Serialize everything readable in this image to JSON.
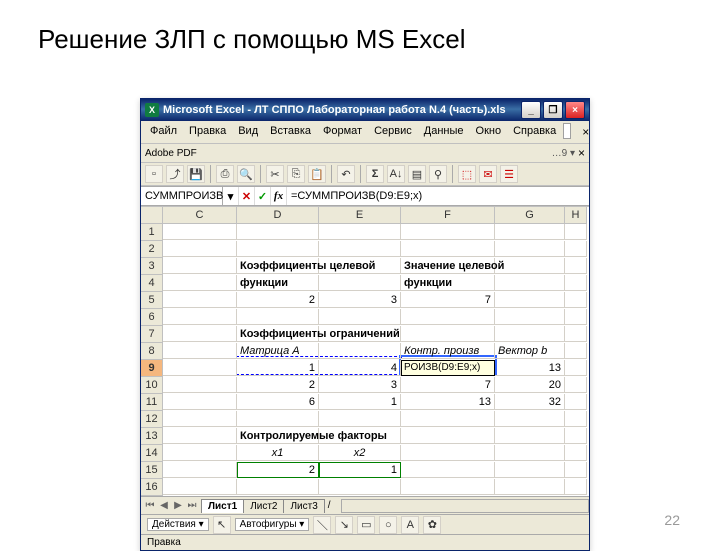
{
  "slide": {
    "title": "Решение ЗЛП с помощью MS Excel",
    "page_number": "22"
  },
  "window": {
    "app_name": "Microsoft Excel",
    "doc_name": "ЛТ СППО Лабораторная работа N.4 (часть).xls"
  },
  "menu": {
    "items": [
      "Файл",
      "Правка",
      "Вид",
      "Вставка",
      "Формат",
      "Сервис",
      "Данные",
      "Окно",
      "Справка"
    ],
    "type_question_placeholder": ""
  },
  "toolbar": {
    "adobe_label": "Adobe PDF",
    "sigma": "Σ"
  },
  "formula": {
    "namebox": "СУММПРОИЗВ",
    "text": "=СУММПРОИЗВ(D9:E9;x)"
  },
  "columns": [
    "C",
    "D",
    "E",
    "F",
    "G",
    "H"
  ],
  "rows": [
    {
      "n": "1",
      "cells": [
        "",
        "",
        "",
        "",
        "",
        ""
      ]
    },
    {
      "n": "2",
      "cells": [
        "",
        "",
        "",
        "",
        "",
        ""
      ]
    },
    {
      "n": "3",
      "cells": [
        "",
        "Коэффициенты целевой",
        "",
        "Значение целевой",
        "",
        ""
      ],
      "bold": true
    },
    {
      "n": "4",
      "cells": [
        "",
        "функции",
        "",
        "функции",
        "",
        ""
      ],
      "bold": true
    },
    {
      "n": "5",
      "cells": [
        "",
        "2",
        "3",
        "7",
        "",
        ""
      ],
      "align": "r"
    },
    {
      "n": "6",
      "cells": [
        "",
        "",
        "",
        "",
        "",
        ""
      ]
    },
    {
      "n": "7",
      "cells": [
        "",
        "Коэффициенты ограничений",
        "",
        "",
        "",
        ""
      ],
      "bold": true
    },
    {
      "n": "8",
      "cells": [
        "",
        "Матрица А",
        "",
        "Контр. произв",
        "Вектор b",
        ""
      ],
      "ital": true
    },
    {
      "n": "9",
      "cells": [
        "",
        "1",
        "4",
        "РОИЗВ(D9:E9;x)",
        "13",
        ""
      ],
      "sel": true,
      "tt": true
    },
    {
      "n": "10",
      "cells": [
        "",
        "2",
        "3",
        "7",
        "20",
        ""
      ],
      "align": "r"
    },
    {
      "n": "11",
      "cells": [
        "",
        "6",
        "1",
        "13",
        "32",
        ""
      ],
      "align": "r"
    },
    {
      "n": "12",
      "cells": [
        "",
        "",
        "",
        "",
        "",
        ""
      ]
    },
    {
      "n": "13",
      "cells": [
        "",
        "Контролируемые факторы",
        "",
        "",
        "",
        ""
      ],
      "bold": true
    },
    {
      "n": "14",
      "cells": [
        "",
        "x1",
        "x2",
        "",
        "",
        ""
      ],
      "ital": true,
      "align": "c"
    },
    {
      "n": "15",
      "cells": [
        "",
        "2",
        "1",
        "",
        "",
        ""
      ],
      "align": "r",
      "green": true
    },
    {
      "n": "16",
      "cells": [
        "",
        "",
        "",
        "",
        "",
        ""
      ]
    }
  ],
  "sheet_tabs": {
    "nav": [
      "⏮",
      "◀",
      "▶",
      "⏭"
    ],
    "tabs": [
      "Лист1",
      "Лист2",
      "Лист3"
    ]
  },
  "drawing": {
    "actions_label": "Действия",
    "autoshapes_label": "Автофигуры"
  },
  "statusbar": {
    "text": "Правка"
  }
}
